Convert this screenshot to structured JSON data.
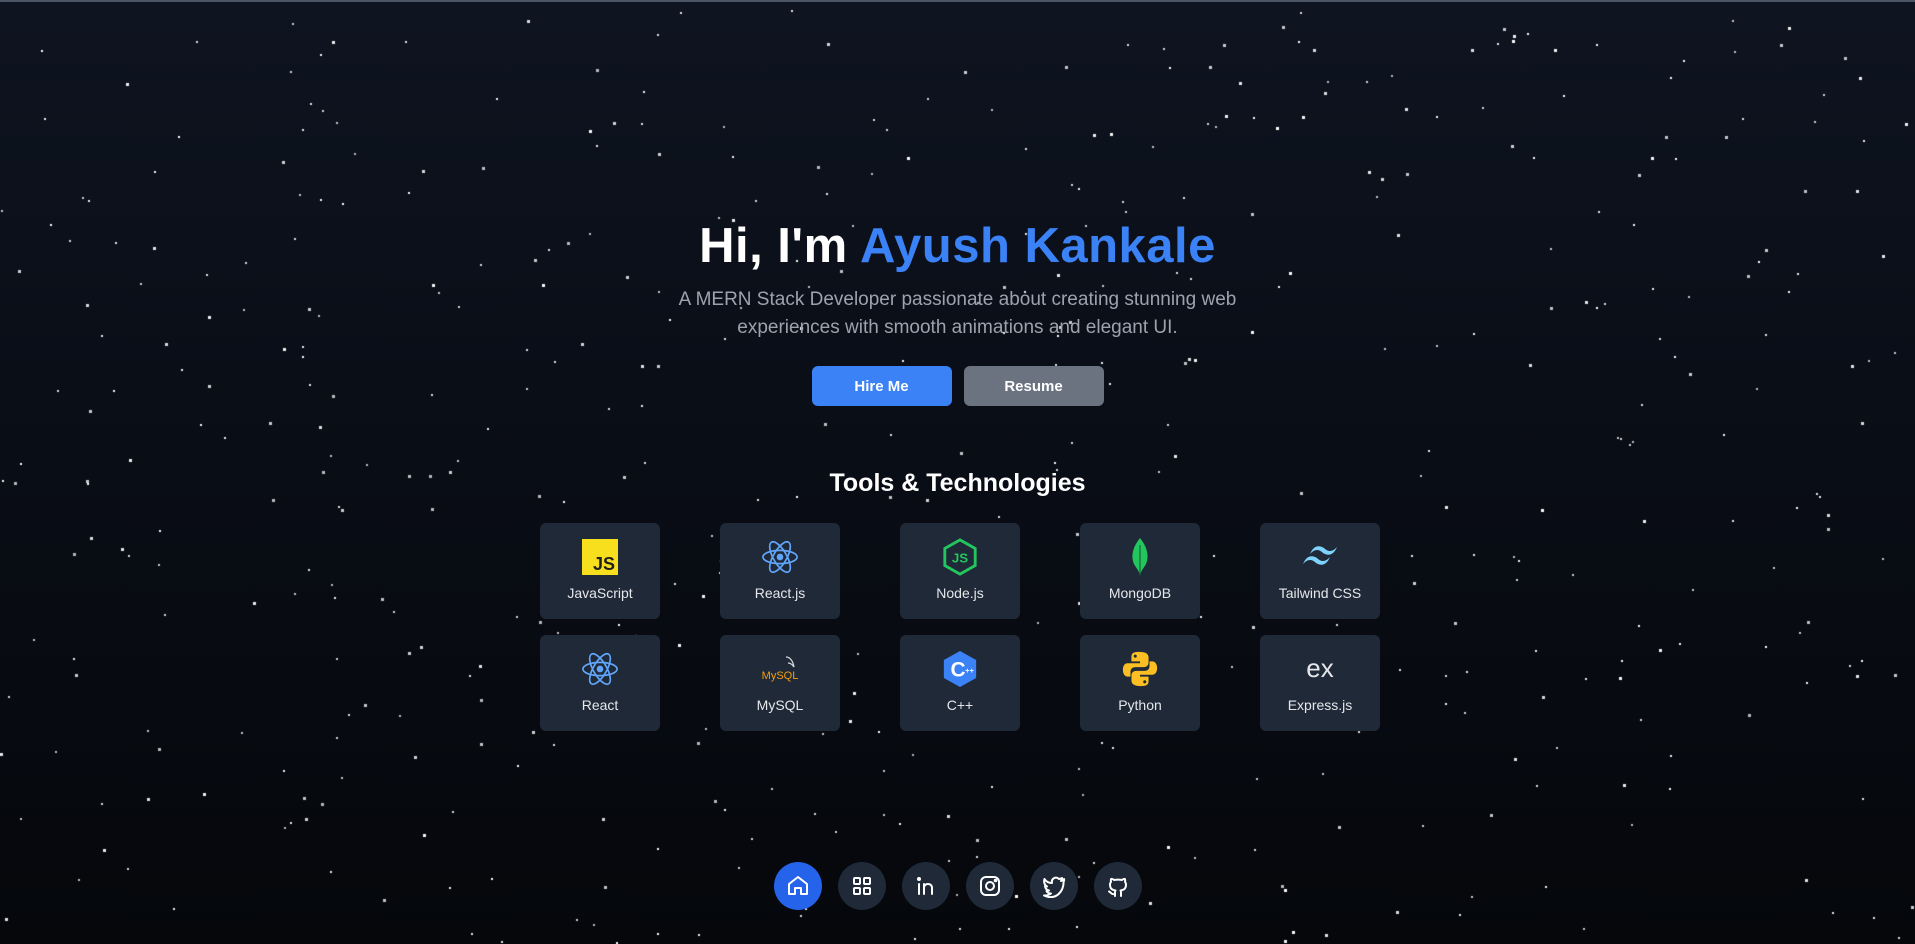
{
  "hero": {
    "greeting": "Hi, I'm",
    "name": "Ayush Kankale",
    "subtitle": "A MERN Stack Developer passionate about creating stunning web experiences with smooth animations and elegant UI.",
    "hire_label": "Hire Me",
    "resume_label": "Resume"
  },
  "tools": {
    "title": "Tools & Technologies",
    "items": [
      {
        "label": "JavaScript",
        "icon": "javascript-icon"
      },
      {
        "label": "React.js",
        "icon": "react-icon"
      },
      {
        "label": "Node.js",
        "icon": "nodejs-icon"
      },
      {
        "label": "MongoDB",
        "icon": "mongodb-icon"
      },
      {
        "label": "Tailwind CSS",
        "icon": "tailwind-icon"
      },
      {
        "label": "React",
        "icon": "react-icon"
      },
      {
        "label": "MySQL",
        "icon": "mysql-icon",
        "icon_text": "MySQL"
      },
      {
        "label": "C++",
        "icon": "cplusplus-icon",
        "icon_text": "C"
      },
      {
        "label": "Python",
        "icon": "python-icon"
      },
      {
        "label": "Express.js",
        "icon": "express-icon",
        "icon_text": "ex"
      }
    ],
    "js_badge": "JS"
  },
  "dock": {
    "items": [
      "home-icon",
      "grid-icon",
      "linkedin-icon",
      "instagram-icon",
      "twitter-icon",
      "github-icon"
    ],
    "active": "home-icon"
  },
  "colors": {
    "accent": "#3b82f6",
    "card_bg": "#1f2937",
    "resume_bg": "#6b7280",
    "dock_active": "#2563eb"
  }
}
